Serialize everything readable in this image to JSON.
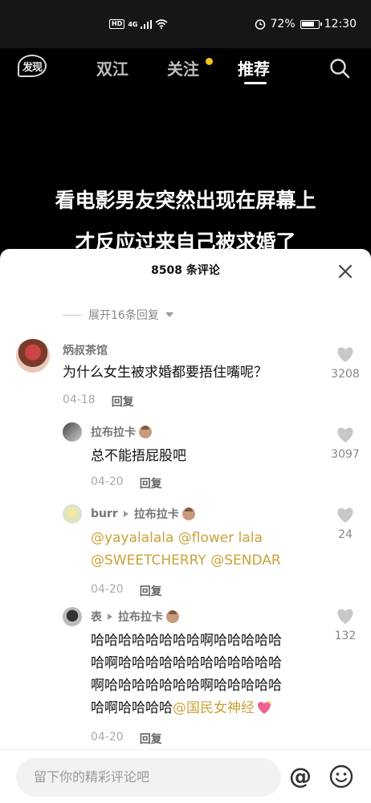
{
  "status_bar": {
    "hd": "HD",
    "net": "4G",
    "battery": "72%",
    "time": "12:30"
  },
  "nav": {
    "discover": "发现",
    "tabs": [
      "双江",
      "关注",
      "推荐"
    ],
    "active_tab": "推荐"
  },
  "video": {
    "caption_line1": "看电影男友突然出现在屏幕上",
    "caption_line2": "才反应过来自己被求婚了"
  },
  "comments_sheet": {
    "title": "8508 条评论",
    "expand_label": "展开16条回复",
    "comments": [
      {
        "user": "炳叔茶馆",
        "text": "为什么女生被求婚都要捂住嘴呢？",
        "date": "04-18",
        "reply_label": "回复",
        "likes": "3208"
      }
    ],
    "replies": [
      {
        "user": "拉布拉卡",
        "text": "总不能捂屁股吧",
        "date": "04-20",
        "reply_label": "回复",
        "likes": "3097"
      },
      {
        "user": "burr",
        "reply_to": "拉布拉卡",
        "text_line1": "@yayalalala @flower lala",
        "text_line2": "@SWEETCHERRY @SENDAR",
        "date": "04-20",
        "reply_label": "回复",
        "likes": "24"
      },
      {
        "user": "表",
        "reply_to": "拉布拉卡",
        "text_line1": "哈哈哈哈哈哈哈哈啊哈哈哈哈哈",
        "text_line2": "哈啊哈哈哈哈哈哈哈哈哈哈哈哈",
        "text_line3": "啊哈哈哈哈哈哈哈啊哈哈哈哈哈",
        "text_line4_plain": "哈啊哈哈哈哈",
        "text_line4_mention": "@国民女神经",
        "date": "04-20",
        "reply_label": "回复",
        "likes": "132"
      }
    ]
  },
  "input": {
    "placeholder": "留下你的精彩评论吧",
    "at_symbol": "@"
  },
  "colors": {
    "accent_gold": "#c9a33a",
    "badge_yellow": "#f5c518"
  }
}
